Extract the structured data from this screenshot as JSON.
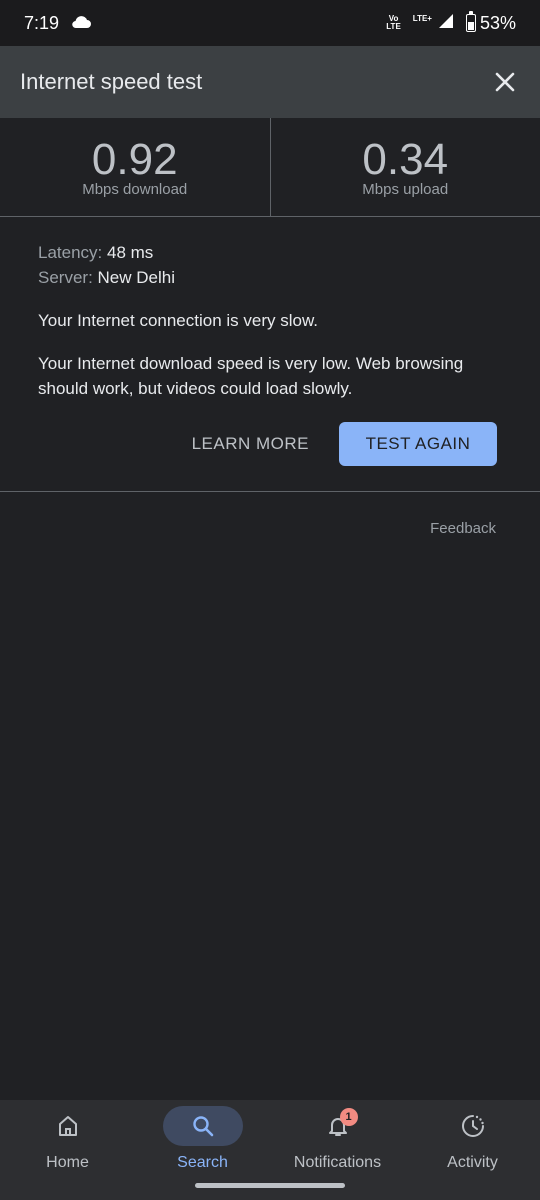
{
  "status_bar": {
    "time": "7:19",
    "volte_top": "Vo",
    "volte_bottom": "LTE",
    "lte": "LTE+",
    "battery": "53%",
    "icons": [
      "cloud-icon",
      "signal-icon",
      "battery-icon"
    ]
  },
  "header": {
    "title": "Internet speed test",
    "close_icon": "close-icon"
  },
  "results": {
    "download": {
      "value": "0.92",
      "unit": "Mbps download"
    },
    "upload": {
      "value": "0.34",
      "unit": "Mbps upload"
    }
  },
  "details": {
    "latency_label": "Latency:",
    "latency_value": "48 ms",
    "server_label": "Server:",
    "server_value": "New Delhi",
    "message_1": "Your Internet connection is very slow.",
    "message_2": "Your Internet download speed is very low. Web browsing should work, but videos could load slowly."
  },
  "actions": {
    "learn_more": "LEARN MORE",
    "test_again": "TEST AGAIN"
  },
  "feedback": "Feedback",
  "bottom_nav": {
    "items": [
      {
        "label": "Home",
        "icon": "home-icon",
        "active": false
      },
      {
        "label": "Search",
        "icon": "search-icon",
        "active": true
      },
      {
        "label": "Notifications",
        "icon": "bell-icon",
        "active": false,
        "badge": "1"
      },
      {
        "label": "Activity",
        "icon": "activity-icon",
        "active": false
      }
    ]
  },
  "colors": {
    "background": "#202124",
    "header": "#3c4043",
    "accent": "#8ab4f8",
    "badge": "#f28b82"
  }
}
